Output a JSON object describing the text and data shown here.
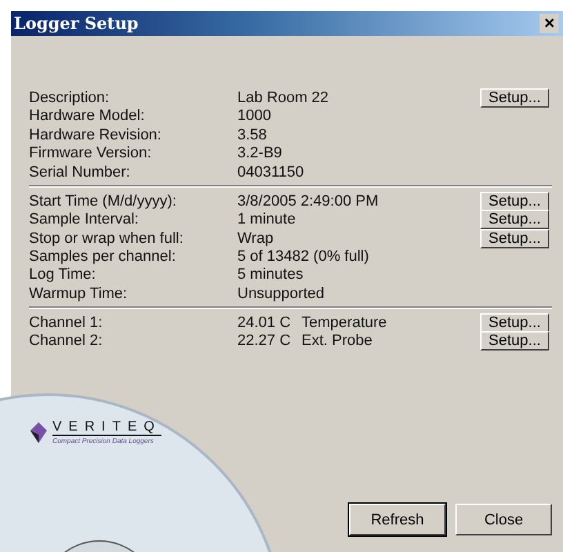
{
  "window": {
    "title": "Logger Setup",
    "close": "×"
  },
  "sections": [
    {
      "rows": [
        {
          "label": "Description:",
          "value": "Lab Room 22",
          "button": "Setup..."
        },
        {
          "label": "Hardware Model:",
          "value": "1000"
        },
        {
          "label": "Hardware Revision:",
          "value": "3.58"
        },
        {
          "label": "Firmware Version:",
          "value": "3.2-B9"
        },
        {
          "label": "Serial Number:",
          "value": "04031150"
        }
      ]
    },
    {
      "rows": [
        {
          "label": "Start Time (M/d/yyyy):",
          "value": "3/8/2005 2:49:00 PM",
          "button": "Setup..."
        },
        {
          "label": "Sample Interval:",
          "value": "1 minute",
          "button": "Setup..."
        },
        {
          "label": "Stop or wrap when full:",
          "value": "Wrap",
          "button": "Setup..."
        },
        {
          "label": "Samples per channel:",
          "value": "5 of 13482  (0% full)"
        },
        {
          "label": "Log Time:",
          "value": "5 minutes"
        },
        {
          "label": "Warmup Time:",
          "value": "Unsupported"
        }
      ]
    },
    {
      "rows": [
        {
          "label": "Channel 1:",
          "value": "24.01 C",
          "type": "Temperature",
          "button": "Setup..."
        },
        {
          "label": "Channel 2:",
          "value": "22.27 C",
          "type": "Ext. Probe",
          "button": "Setup..."
        }
      ]
    }
  ],
  "buttons": [
    {
      "label": "Refresh",
      "default": true
    },
    {
      "label": "Close",
      "default": false
    }
  ],
  "disc": {
    "brand": "VERITEQ",
    "tagline": "Compact Precision Data Loggers"
  }
}
